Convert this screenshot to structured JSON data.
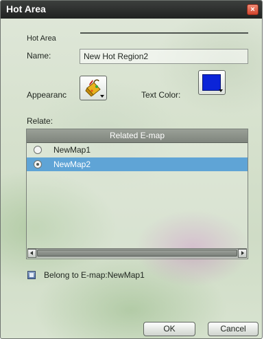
{
  "dialog": {
    "title": "Hot Area",
    "close_label": "×"
  },
  "form": {
    "section_label": "Hot Area",
    "name_label": "Name:",
    "name_value": "New Hot Region2",
    "appearance_label": "Appearanc",
    "text_color_label": "Text Color:",
    "text_color_value": "#0b24d8",
    "relate_label": "Relate:"
  },
  "table": {
    "header": "Related E-map",
    "rows": [
      {
        "label": "NewMap1",
        "selected": false
      },
      {
        "label": "NewMap2",
        "selected": true
      }
    ]
  },
  "belong": {
    "label": "Belong to E-map:NewMap1"
  },
  "buttons": {
    "ok": "OK",
    "cancel": "Cancel"
  },
  "icons": {
    "appearance": "paint-bucket-icon",
    "close": "close-icon"
  }
}
